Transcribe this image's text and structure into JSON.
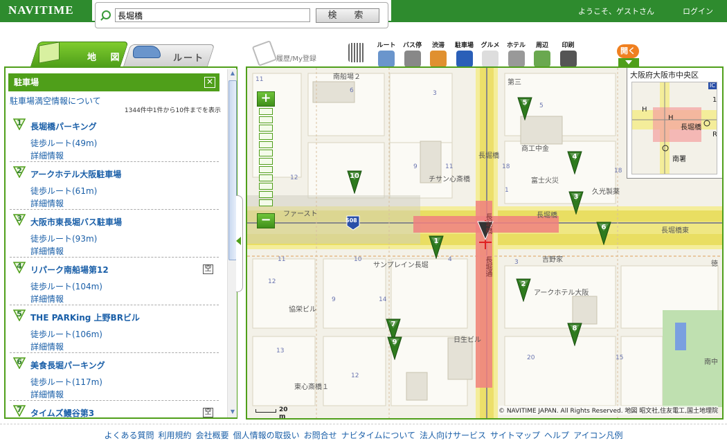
{
  "header": {
    "logo": "NAVITIME",
    "search_value": "長堀橋",
    "search_button": "検　索",
    "welcome": "ようこそ、ゲストさん",
    "login": "ログイン"
  },
  "tabs": {
    "map": "地 図",
    "route": "ルート"
  },
  "toolbar": {
    "history": "履歴/My登録",
    "tools": [
      "ルート",
      "バス停",
      "渋滞",
      "駐車場",
      "グルメ",
      "ホテル",
      "周辺",
      "印刷"
    ],
    "open": "開く"
  },
  "panel": {
    "title": "駐車場",
    "close": "✕",
    "link": "駐車場満空情報について",
    "count": "1344件中1件から10件までを表示",
    "items": [
      {
        "num": "1",
        "name": "長堀橋パーキング",
        "walk": "徒歩ルート(49m)",
        "detail": "詳細情報",
        "vacancy": ""
      },
      {
        "num": "2",
        "name": "アークホテル大阪駐車場",
        "walk": "徒歩ルート(61m)",
        "detail": "詳細情報",
        "vacancy": ""
      },
      {
        "num": "3",
        "name": "大阪市東長堀バス駐車場",
        "walk": "徒歩ルート(93m)",
        "detail": "詳細情報",
        "vacancy": ""
      },
      {
        "num": "4",
        "name": "リパーク南船場第12",
        "walk": "徒歩ルート(104m)",
        "detail": "詳細情報",
        "vacancy": "空"
      },
      {
        "num": "5",
        "name": "THE PARKing 上野BRビル",
        "walk": "徒歩ルート(106m)",
        "detail": "詳細情報",
        "vacancy": ""
      },
      {
        "num": "6",
        "name": "美食長堀パーキング",
        "walk": "徒歩ルート(117m)",
        "detail": "詳細情報",
        "vacancy": ""
      },
      {
        "num": "7",
        "name": "タイムズ鰻谷第3",
        "walk": "",
        "detail": "",
        "vacancy": "空"
      }
    ]
  },
  "map": {
    "overview_title": "大阪府大阪市中央区",
    "overview_labels": [
      "長堀橋",
      "南署",
      "H",
      "H",
      "R",
      "IC",
      "1"
    ],
    "labels": [
      "南船場２",
      "第三",
      "商工中金",
      "長堀橋",
      "チサン心斎橋",
      "富士火災",
      "久光製薬",
      "ファースト",
      "長堀橋",
      "長堀橋東",
      "サンプレイン長堀",
      "吉野家",
      "アークホテル大阪",
      "協栄ビル",
      "日生ビル",
      "東心斎橋１",
      "南中",
      "長堀橋",
      "長堀通",
      "徳"
    ],
    "block_numbers": [
      "11",
      "6",
      "3",
      "5",
      "11",
      "18",
      "12",
      "9",
      "1",
      "11",
      "10",
      "4",
      "3",
      "2",
      "12",
      "9",
      "14",
      "13",
      "20",
      "15",
      "12",
      "11",
      "18"
    ],
    "route_marker": "508",
    "pins": [
      "1",
      "2",
      "3",
      "4",
      "5",
      "6",
      "7",
      "8",
      "9",
      "10"
    ],
    "scale": "20 m",
    "copyright": "© NAVITIME JAPAN. All Rights Reserved. 地図 昭文社,住友電工,国土地理院"
  },
  "footer": {
    "links": [
      "よくある質問",
      "利用規約",
      "会社概要",
      "個人情報の取扱い",
      "お問合せ",
      "ナビタイムについて",
      "法人向けサービス",
      "サイトマップ",
      "ヘルプ",
      "アイコン凡例"
    ]
  },
  "colors": {
    "brand": "#2e8b2e",
    "accent": "#4f9f1a",
    "road_major": "#f2e87a",
    "highlight": "#f08080",
    "link": "#1a5fa8",
    "open": "#f08020"
  }
}
